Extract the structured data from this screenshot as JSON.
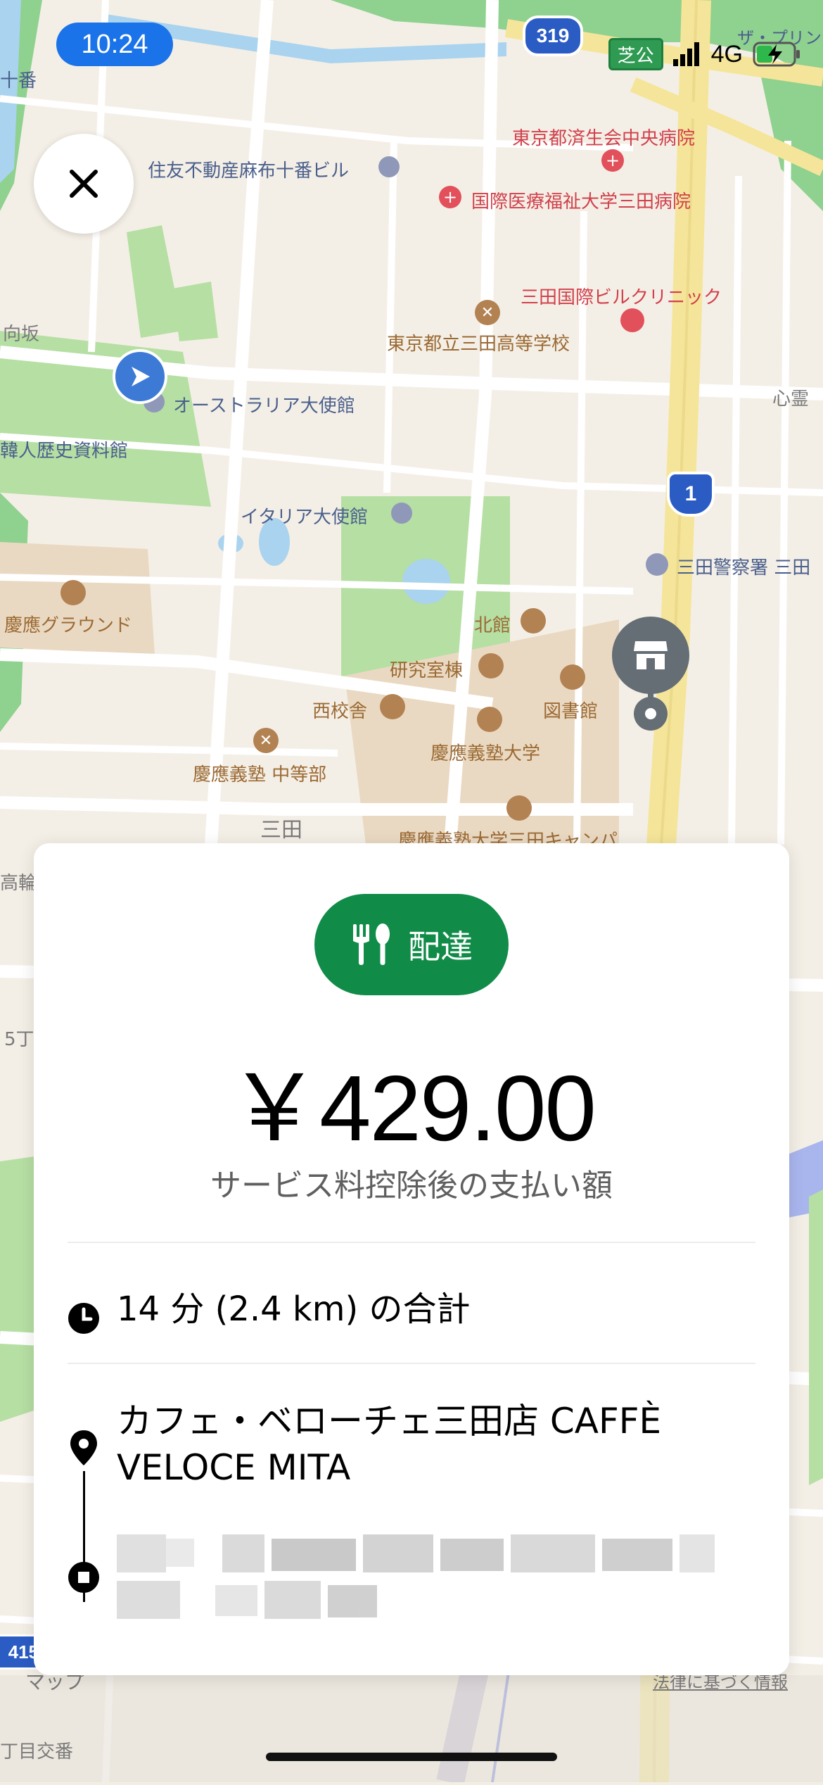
{
  "status_bar": {
    "time": "10:24",
    "carrier_badge": "芝公",
    "network": "4G"
  },
  "map": {
    "route_badge_319": "319",
    "route_badge_1": "1",
    "route_badge_415": "415",
    "labels": {
      "hospital_saiseikai": "東京都済生会中央病院",
      "hospital_iryofukushi": "国際医療福祉大学三田病院",
      "building_sumitomo": "住友不動産麻布十番ビル",
      "clinic_mita": "三田国際ビルクリニック",
      "school_mita": "東京都立三田高等学校",
      "embassy_australia": "オーストラリア大使館",
      "museum_korean": "韓人歴史資料館",
      "embassy_italy": "イタリア大使館",
      "police_mita": "三田警察署 三田",
      "ground_keio": "慶應グラウンド",
      "hall_north": "北館",
      "hall_research": "研究室棟",
      "hall_west": "西校舎",
      "library": "図書館",
      "university_keio": "慶應義塾大学",
      "school_keio_chutobu": "慶應義塾 中等部",
      "area_mita": "三田",
      "campus_keio": "慶應義塾大学三田キャンパ",
      "area_juban": "十番",
      "area_mukouzaka": "向坂",
      "area_shinrei": "心霊",
      "area_topright": "ザ・プリン",
      "area_takanawa": "高輪",
      "area_5chome": "5丁",
      "area_choume": "丁目交番",
      "attribution_maps": "マップ",
      "attribution_legal": "法律に基づく情報"
    }
  },
  "card": {
    "badge_label": "配達",
    "price": "￥429.00",
    "subtitle": "サービス料控除後の支払い額",
    "duration": "14 分 (2.4 km) の合計",
    "restaurant": "カフェ・ベローチェ三田店 CAFFÈ VELOCE MITA",
    "dropoff_address": "",
    "colors": {
      "badge": "#108c48",
      "price": "#000000"
    }
  },
  "icons": [
    "close-icon",
    "fork-spoon-icon",
    "clock-icon",
    "pickup-pin-icon",
    "dropoff-square-icon",
    "store-icon",
    "location-arrow-icon"
  ]
}
